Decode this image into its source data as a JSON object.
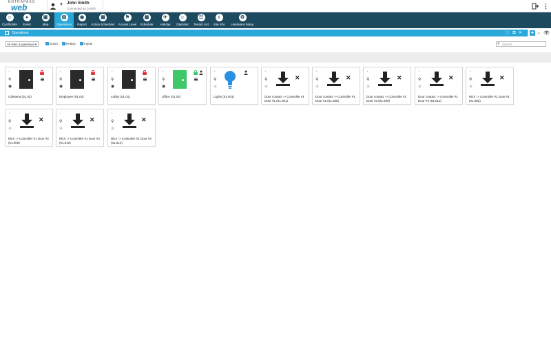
{
  "app": {
    "brand_top": "ENTRAPASS",
    "brand_bottom": "web"
  },
  "user": {
    "name": "John Smith",
    "connected": "Connected as: jsmith"
  },
  "nav": [
    {
      "label": "Cardholder",
      "icon": "cardholder-icon",
      "glyph": "☺",
      "active": false
    },
    {
      "label": "Event",
      "icon": "event-icon",
      "glyph": "●",
      "active": false
    },
    {
      "label": "Map",
      "icon": "map-icon",
      "glyph": "▣",
      "active": false
    },
    {
      "label": "Operations",
      "icon": "operations-icon",
      "glyph": "▤",
      "active": true
    },
    {
      "label": "Report",
      "icon": "report-icon",
      "glyph": "◉",
      "active": false
    },
    {
      "label": "Action Scheduler",
      "icon": "action-scheduler-icon",
      "glyph": "▦",
      "active": false
    },
    {
      "label": "Access Level",
      "icon": "access-level-icon",
      "glyph": "⚑",
      "active": false
    },
    {
      "label": "Schedule",
      "icon": "schedule-icon",
      "glyph": "▦",
      "active": false
    },
    {
      "label": "Holiday",
      "icon": "holiday-icon",
      "glyph": "✈",
      "active": false
    },
    {
      "label": "Operator",
      "icon": "operator-icon",
      "glyph": "☺",
      "active": false
    },
    {
      "label": "Tenant List",
      "icon": "tenant-list-icon",
      "glyph": "☷",
      "active": false
    },
    {
      "label": "Site Info",
      "icon": "site-info-icon",
      "glyph": "i",
      "active": false
    },
    {
      "label": "Hardware Setup",
      "icon": "hardware-setup-icon",
      "glyph": "⚙",
      "active": false
    }
  ],
  "window": {
    "title": "Operations"
  },
  "filters": {
    "site_select": "All sites & gateways",
    "doors": "Doors",
    "relays": "Relays",
    "inputs": "Inputs",
    "search_placeholder": "Search..."
  },
  "colors": {
    "nav_bg": "#1e4a5f",
    "accent": "#29a8d9",
    "locked": "#e0303a",
    "open_door": "#3ec86a",
    "light_on": "#2a8fe0"
  },
  "cards": [
    {
      "type": "door",
      "label": "Cafeteria (01.02)",
      "state": "locked",
      "door_color": "dark"
    },
    {
      "type": "door",
      "label": "Employee (01.04)",
      "state": "locked",
      "door_color": "dark"
    },
    {
      "type": "door",
      "label": "Lobby (01.01)",
      "state": "locked",
      "door_color": "dark"
    },
    {
      "type": "door",
      "label": "Office (01.03)",
      "state": "unlocked",
      "door_color": "green"
    },
    {
      "type": "relay",
      "label": "Lights (01.001)"
    },
    {
      "type": "input",
      "label": "Door contact -> Controller #1 Door #1 (01.001)"
    },
    {
      "type": "input",
      "label": "Door contact -> Controller #1 Door #2 (01.005)"
    },
    {
      "type": "input",
      "label": "Door contact -> Controller #1 Door #3 (01.009)"
    },
    {
      "type": "input",
      "label": "Door contact -> Controller #1 Door #4 (01.013)"
    },
    {
      "type": "input",
      "label": "REX -> Controller #1 Door #1 (01.002)"
    },
    {
      "type": "input",
      "label": "REX -> Controller #1 Door #2 (01.006)"
    },
    {
      "type": "input",
      "label": "REX -> Controller #1 Door #3 (01.010)"
    },
    {
      "type": "input",
      "label": "REX -> Controller #1 Door #4 (01.014)"
    }
  ]
}
